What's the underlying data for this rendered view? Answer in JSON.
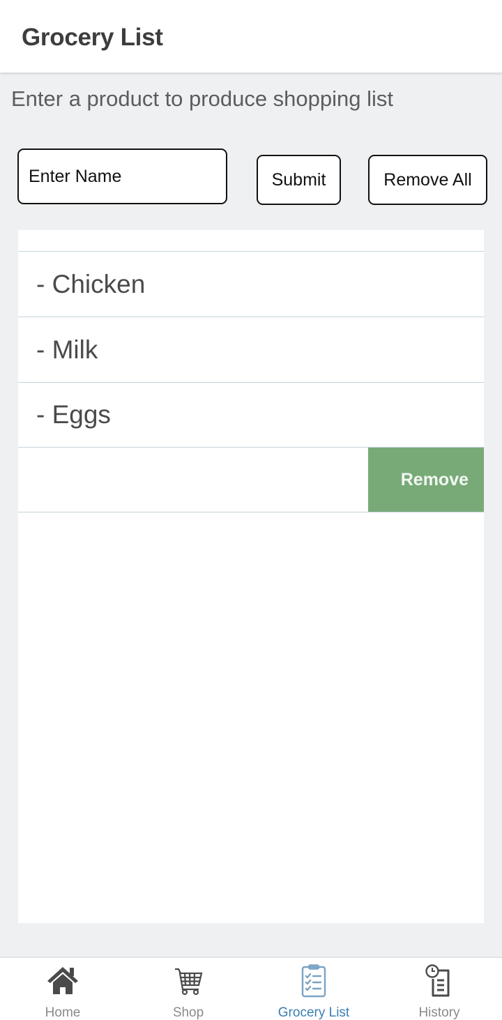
{
  "header": {
    "title": "Grocery List"
  },
  "main": {
    "subtitle": "Enter a product to produce shopping list",
    "name_input": {
      "value": "",
      "placeholder": "Enter Name"
    },
    "submit_label": "Submit",
    "remove_all_label": "Remove All",
    "list": {
      "items": [
        {
          "label": "- Chicken"
        },
        {
          "label": "- Milk"
        },
        {
          "label": "- Eggs"
        },
        {
          "label": ""
        }
      ],
      "swipe_action_label": "Remove",
      "swipe_action_color": "#78aa78"
    }
  },
  "bottom_nav": {
    "active_color": "#3a7fb3",
    "items": [
      {
        "label": "Home",
        "icon": "home-icon",
        "active": false
      },
      {
        "label": "Shop",
        "icon": "shopping-cart-icon",
        "active": false
      },
      {
        "label": "Grocery List",
        "icon": "clipboard-checklist-icon",
        "active": true
      },
      {
        "label": "History",
        "icon": "history-document-icon",
        "active": false
      }
    ]
  }
}
